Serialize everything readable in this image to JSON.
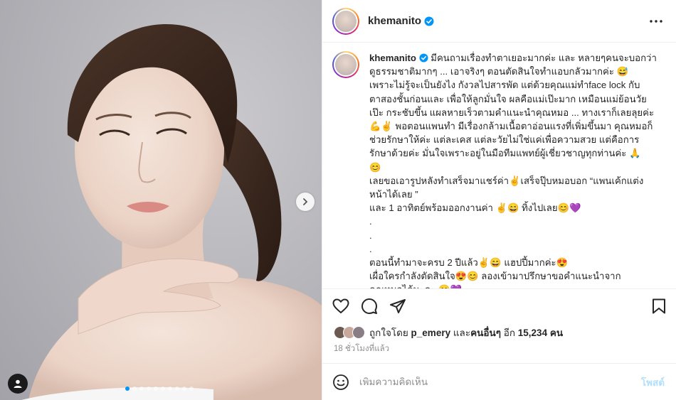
{
  "post": {
    "username": "khemanito",
    "verified": true,
    "carousel": {
      "total_slides": 10,
      "current_slide": 1
    }
  },
  "icons": {
    "more": "more-horizontal-icon",
    "next": "chevron-right-icon",
    "user_tag": "user-tag-icon",
    "like": "heart-icon",
    "comment": "comment-bubble-icon",
    "share": "paper-plane-icon",
    "save": "bookmark-icon",
    "emoji": "smiley-icon",
    "verified": "verified-badge-icon"
  },
  "caption": {
    "username": "khemanito",
    "lines": [
      "มีคนถามเรื่องทำตาเยอะมากค่ะ และ หลายๆคนจะบอกว่า",
      "ดูธรรมชาติมากๆ ... เอาจริงๆ ตอนตัดสินใจทำแอบกลัวมากค่ะ 😅",
      "เพราะไม่รู้จะเป็นยังไง กังวลไปสารพัด แต่ด้วยคุณแม่ทำface lock กับ",
      "ตาสองชั้นก่อนและ เพื่อให้ลูกมั่นใจ ผลคือแม่เป๊ะมาก เหมือนแม่ย้อนวัย",
      "เป๊ะ กระชับขึ้น แผลหายเร็วตามคำแนะนำคุณหมอ ... ทางเราก็เลยลุยค่ะ",
      "💪✌ พอตอนแพนทำ มีเรื่องกล้ามเนื้อตาอ่อนแรงที่เพิ่มขึ้นมา คุณหมอก็",
      "ช่วยรักษาให้ค่ะ แต่ละเคส แต่ละวัยไม่ใช่แค่เพื่อความสวย แต่คือการ",
      "รักษาด้วยค่ะ มั่นใจเพราะอยู่ในมือทีมแพทย์ผู้เชี่ยวชาญทุกท่านค่ะ 🙏",
      "😊",
      "เลยขอเอารูปหลังทำเสร็จมาแชร์ค่า✌เสร็จปุ๊บหมอบอก “แพนเค้กแต่ง",
      "หน้าได้เลย ”",
      "และ 1 อาทิตย์พร้อมออกงานค่า ✌😄 ทิ้งไปเลย😊💜",
      ".",
      ".",
      ".",
      "ตอนนี้ทำมาจะครบ 2 ปีแล้ว✌😄 แฮปปี้มากค่ะ😍",
      "เผื่อใครกำลังตัดสินใจ😍😊 ลองเข้ามาปรึกษาขอคำแนะนำจาก",
      "คุณหมอได้นะคะ 😊💜"
    ]
  },
  "likes": {
    "prefix": "ถูกใจโดย",
    "by_user": "p_emery",
    "and": "และ",
    "others": "คนอื่นๆ",
    "more": "อีก",
    "count": "15,234",
    "unit": "คน"
  },
  "timestamp": "18 ชั่วโมงที่แล้ว",
  "comment": {
    "placeholder": "เพิ่มความคิดเห็น",
    "post_label": "โพสต์"
  },
  "colors": {
    "accent": "#0095f6",
    "post_disabled": "#b2dffc",
    "muted": "#8e8e8e"
  }
}
